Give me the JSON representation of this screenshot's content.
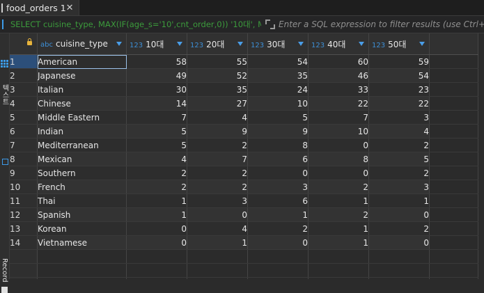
{
  "tab": {
    "title": "food_orders 1",
    "close_glyph": "✕"
  },
  "filter": {
    "sql_text": "SELECT cuisine_type, MAX(IF(age_s='10',cnt_order,0)) '10대', MAX(",
    "placeholder": "Enter a SQL expression to filter results (use Ctrl+Space)"
  },
  "sidebar": {
    "top_label": "텍스트",
    "bottom_label": "Record"
  },
  "columns": [
    {
      "type_badge": "abc",
      "label": "cuisine_type"
    },
    {
      "type_badge": "123",
      "label": "10대"
    },
    {
      "type_badge": "123",
      "label": "20대"
    },
    {
      "type_badge": "123",
      "label": "30대"
    },
    {
      "type_badge": "123",
      "label": "40대"
    },
    {
      "type_badge": "123",
      "label": "50대"
    }
  ],
  "rows": [
    {
      "num": "1",
      "cuisine": "American",
      "v10": "58",
      "v20": "55",
      "v30": "54",
      "v40": "60",
      "v50": "59"
    },
    {
      "num": "2",
      "cuisine": "Japanese",
      "v10": "49",
      "v20": "52",
      "v30": "35",
      "v40": "46",
      "v50": "54"
    },
    {
      "num": "3",
      "cuisine": "Italian",
      "v10": "30",
      "v20": "35",
      "v30": "24",
      "v40": "33",
      "v50": "23"
    },
    {
      "num": "4",
      "cuisine": "Chinese",
      "v10": "14",
      "v20": "27",
      "v30": "10",
      "v40": "22",
      "v50": "22"
    },
    {
      "num": "5",
      "cuisine": "Middle Eastern",
      "v10": "7",
      "v20": "4",
      "v30": "5",
      "v40": "7",
      "v50": "3"
    },
    {
      "num": "6",
      "cuisine": "Indian",
      "v10": "5",
      "v20": "9",
      "v30": "9",
      "v40": "10",
      "v50": "4"
    },
    {
      "num": "7",
      "cuisine": "Mediterranean",
      "v10": "5",
      "v20": "2",
      "v30": "8",
      "v40": "0",
      "v50": "2"
    },
    {
      "num": "8",
      "cuisine": "Mexican",
      "v10": "4",
      "v20": "7",
      "v30": "6",
      "v40": "8",
      "v50": "5"
    },
    {
      "num": "9",
      "cuisine": "Southern",
      "v10": "2",
      "v20": "2",
      "v30": "0",
      "v40": "0",
      "v50": "2"
    },
    {
      "num": "10",
      "cuisine": "French",
      "v10": "2",
      "v20": "2",
      "v30": "3",
      "v40": "2",
      "v50": "3"
    },
    {
      "num": "11",
      "cuisine": "Thai",
      "v10": "1",
      "v20": "3",
      "v30": "6",
      "v40": "1",
      "v50": "1"
    },
    {
      "num": "12",
      "cuisine": "Spanish",
      "v10": "1",
      "v20": "0",
      "v30": "1",
      "v40": "2",
      "v50": "0"
    },
    {
      "num": "13",
      "cuisine": "Korean",
      "v10": "0",
      "v20": "4",
      "v30": "2",
      "v40": "1",
      "v50": "2"
    },
    {
      "num": "14",
      "cuisine": "Vietnamese",
      "v10": "0",
      "v20": "1",
      "v30": "0",
      "v40": "1",
      "v50": "0"
    }
  ],
  "colors": {
    "accent": "#3d9be9",
    "selection": "#275582",
    "sql_green": "#3c9b3c"
  },
  "icons": {
    "tab": "table-icon",
    "filter": "sql-icon",
    "expand": "expand-icon",
    "sidebar_grid": "grid-icon",
    "corner": "lock-icon",
    "sort": "sort-icon"
  }
}
